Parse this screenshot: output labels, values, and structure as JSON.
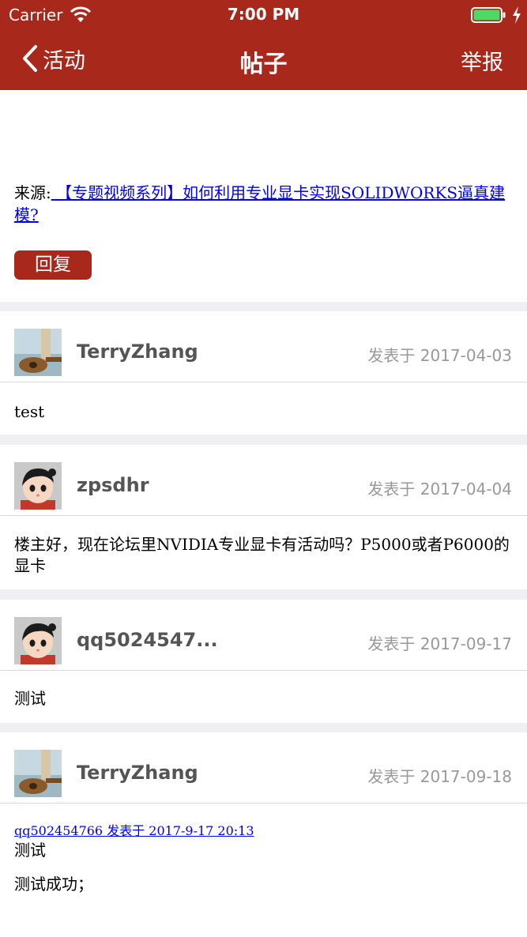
{
  "status": {
    "carrier": "Carrier",
    "time": "7:00 PM"
  },
  "nav": {
    "back_label": "活动",
    "title": "帖子",
    "report_label": "举报"
  },
  "topic": {
    "source_prefix": "来源:",
    "source_link": " 【专题视频系列】如何利用专业显卡实现SOLIDWORKS逼真建模?",
    "reply_label": "回复"
  },
  "posts": [
    {
      "username": "TerryZhang",
      "date": "发表于 2017-04-03",
      "body": "test"
    },
    {
      "username": "zpsdhr",
      "date": "发表于 2017-04-04",
      "body": "楼主好，现在论坛里NVIDIA专业显卡有活动吗？P5000或者P6000的显卡"
    },
    {
      "username": "qq5024547...",
      "date": "发表于 2017-09-17",
      "body": "测试"
    },
    {
      "username": "TerryZhang",
      "date": "发表于 2017-09-18",
      "quote": "qq502454766 发表于 2017-9-17 20:13",
      "quote_text": "测试",
      "body": "测试成功；"
    }
  ],
  "colors": {
    "brand": "#a8281b",
    "link": "#0000ee",
    "separator": "#efeff4"
  }
}
